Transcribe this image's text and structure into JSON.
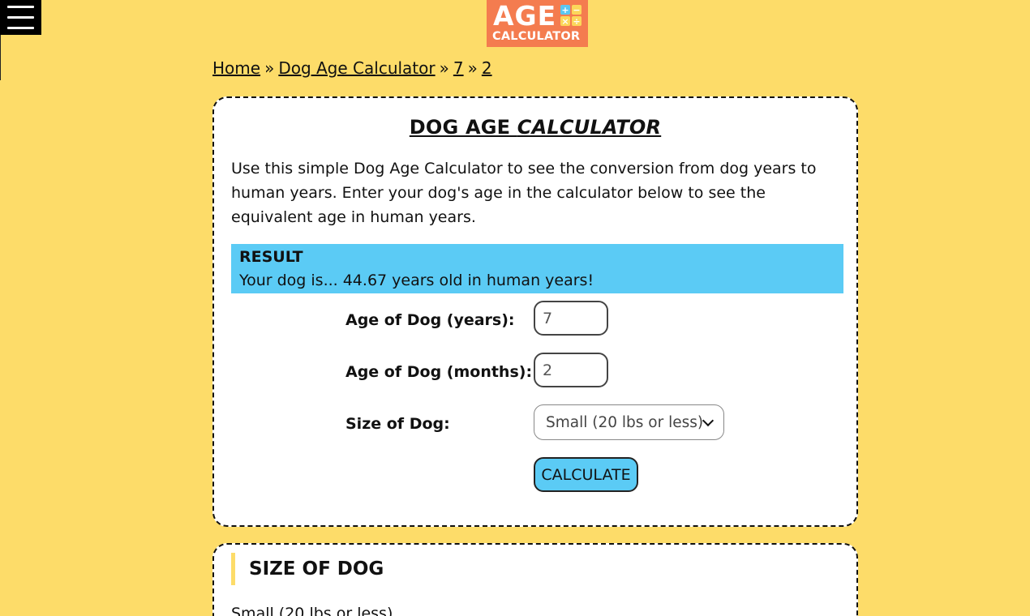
{
  "header": {
    "menu_icon": "hamburger-menu-icon",
    "logo": {
      "line1": "AGE",
      "line2": "CALCULATOR",
      "symbols": [
        "+",
        "−",
        "×",
        "÷"
      ]
    }
  },
  "breadcrumb": {
    "items": [
      "Home",
      "Dog Age Calculator",
      "7",
      "2"
    ],
    "separator": "»"
  },
  "calculator": {
    "title_part1": "DOG AGE ",
    "title_part2": "CALCULATOR",
    "intro": "Use this simple Dog Age Calculator to see the conversion from dog years to human years. Enter your dog's age in the calculator below to see the equivalent age in human years.",
    "result": {
      "label": "RESULT",
      "text": "Your dog is... 44.67 years old in human years!"
    },
    "fields": {
      "years_label": "Age of Dog (years):",
      "years_value": "7",
      "months_label": "Age of Dog (months):",
      "months_value": "2",
      "size_label": "Size of Dog:",
      "size_selected": "Small (20 lbs or less)"
    },
    "button_label": "CALCULATE"
  },
  "size_section": {
    "heading": "SIZE OF DOG",
    "first_item": "Small (20 lbs or less)"
  },
  "colors": {
    "background": "#fddc69",
    "logo": "#f47c4f",
    "result_bg": "#5bcbf5",
    "button_bg": "#5bcbf5"
  }
}
